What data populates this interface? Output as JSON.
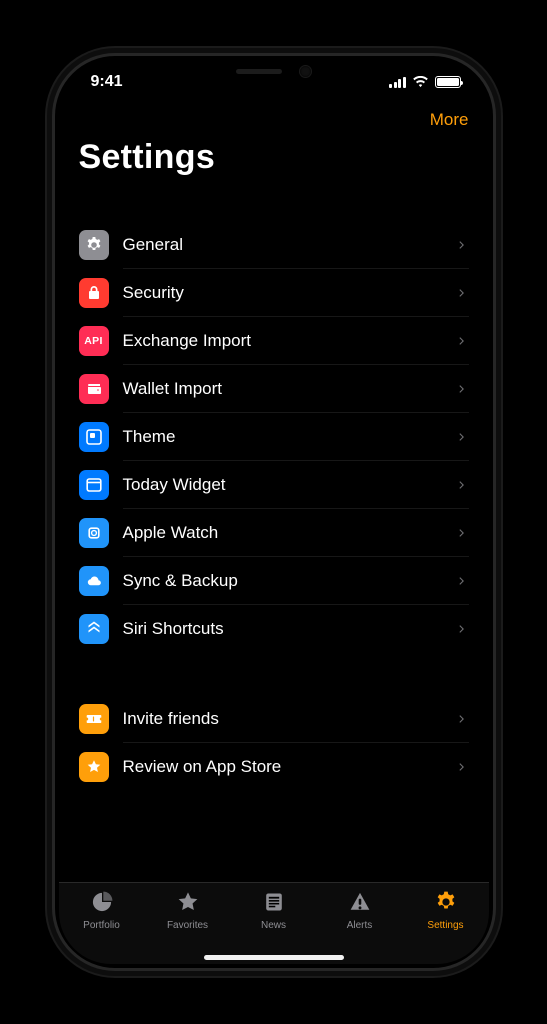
{
  "statusbar": {
    "time": "9:41"
  },
  "nav": {
    "more": "More"
  },
  "title": "Settings",
  "settings_items": [
    {
      "id": "general",
      "label": "General",
      "icon": "gear-icon",
      "color": "bg-gray"
    },
    {
      "id": "security",
      "label": "Security",
      "icon": "lock-icon",
      "color": "bg-red"
    },
    {
      "id": "exchange-import",
      "label": "Exchange Import",
      "icon": "api-icon",
      "color": "bg-pink"
    },
    {
      "id": "wallet-import",
      "label": "Wallet Import",
      "icon": "wallet-icon",
      "color": "bg-pink"
    },
    {
      "id": "theme",
      "label": "Theme",
      "icon": "theme-icon",
      "color": "bg-blue"
    },
    {
      "id": "today-widget",
      "label": "Today Widget",
      "icon": "widget-icon",
      "color": "bg-blue"
    },
    {
      "id": "apple-watch",
      "label": "Apple Watch",
      "icon": "watch-icon",
      "color": "bg-lightb"
    },
    {
      "id": "sync-backup",
      "label": "Sync & Backup",
      "icon": "cloud-icon",
      "color": "bg-lightb"
    },
    {
      "id": "siri-shortcuts",
      "label": "Siri Shortcuts",
      "icon": "shortcuts-icon",
      "color": "bg-lightb"
    }
  ],
  "promo_items": [
    {
      "id": "invite-friends",
      "label": "Invite friends",
      "icon": "ticket-icon",
      "color": "bg-orange"
    },
    {
      "id": "review-appstore",
      "label": "Review on App Store",
      "icon": "star-icon",
      "color": "bg-orange"
    }
  ],
  "tabs": [
    {
      "id": "portfolio",
      "label": "Portfolio",
      "icon": "pie-icon",
      "active": false
    },
    {
      "id": "favorites",
      "label": "Favorites",
      "icon": "star-icon",
      "active": false
    },
    {
      "id": "news",
      "label": "News",
      "icon": "news-icon",
      "active": false
    },
    {
      "id": "alerts",
      "label": "Alerts",
      "icon": "alert-icon",
      "active": false
    },
    {
      "id": "settings",
      "label": "Settings",
      "icon": "gear-icon",
      "active": true
    }
  ],
  "accent_color": "#ff9f0a"
}
